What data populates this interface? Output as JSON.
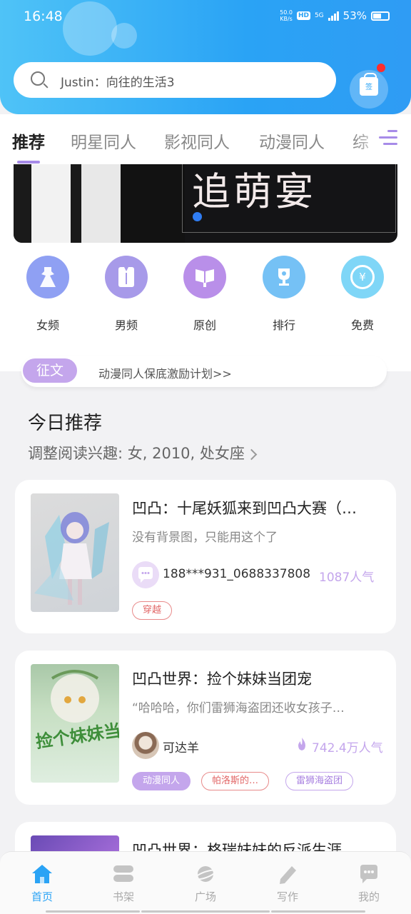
{
  "status_bar": {
    "time": "16:48",
    "net_speed": "50.0",
    "net_unit": "KB/s",
    "hd": "HD",
    "network": "5G",
    "battery": "53%"
  },
  "search": {
    "placeholder": "Justin：向往的生活3"
  },
  "sign_in": {
    "label": "签"
  },
  "tabs": [
    "推荐",
    "明星同人",
    "影视同人",
    "动漫同人",
    "综"
  ],
  "banner": {
    "title": "追萌宴"
  },
  "categories": [
    {
      "label": "女频",
      "icon": "dress-icon",
      "color": "#8fa0f3"
    },
    {
      "label": "男频",
      "icon": "shirt-icon",
      "color": "#a79ae9"
    },
    {
      "label": "原创",
      "icon": "book-icon",
      "color": "#b98fe9"
    },
    {
      "label": "排行",
      "icon": "trophy-icon",
      "color": "#75c1f5"
    },
    {
      "label": "免费",
      "icon": "coin-icon",
      "color": "#7fd6f7"
    }
  ],
  "notice": {
    "tag": "征文",
    "text": "动漫同人保底激励计划>>"
  },
  "today": {
    "title": "今日推荐",
    "subtitle": "调整阅读兴趣: 女, 2010, 处女座"
  },
  "books": [
    {
      "title": "凹凸：十尾妖狐来到凹凸大赛（…",
      "desc": "没有背景图，只能用这个了",
      "author": "188***931_0688337808",
      "popularity": "1087人气",
      "tags": [
        "穿越"
      ]
    },
    {
      "title": "凹凸世界：捡个妹妹当团宠",
      "desc": "“哈哈哈，你们雷狮海盗团还收女孩子…",
      "author": "可达羊",
      "popularity": "742.4万人气",
      "tags": [
        "动漫同人",
        "帕洛斯的…",
        "雷狮海盗团"
      ],
      "cover_text": "捡个妹妹当团宠"
    },
    {
      "title": "凹凸世界：格瑞妹妹的反派生涯"
    }
  ],
  "bottom_nav": [
    {
      "label": "首页",
      "active": true
    },
    {
      "label": "书架",
      "active": false
    },
    {
      "label": "广场",
      "active": false
    },
    {
      "label": "写作",
      "active": false
    },
    {
      "label": "我的",
      "active": false
    }
  ],
  "colors": {
    "accent_blue": "#2aa3f5",
    "accent_purple": "#c4a6ec",
    "tag_red": "#e26767"
  }
}
